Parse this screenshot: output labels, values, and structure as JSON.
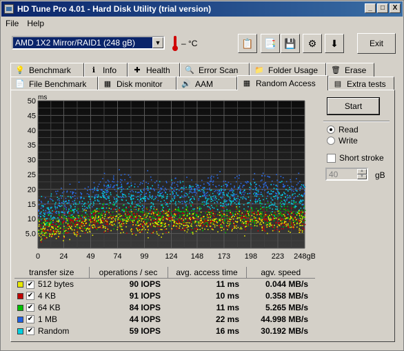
{
  "window": {
    "title": "HD Tune Pro 4.01 - Hard Disk Utility (trial version)",
    "min": "_",
    "max": "□",
    "close": "X"
  },
  "menu": [
    "File",
    "Help"
  ],
  "toolbar": {
    "device": "AMD      1X2 Mirror/RAID1 (248 gB)",
    "temperature": "– °C",
    "exit_label": "Exit"
  },
  "tabs_row1": [
    {
      "label": "Benchmark",
      "icon": "benchmark-icon",
      "glyph": "💡",
      "w": 107
    },
    {
      "label": "Info",
      "icon": "info-icon",
      "glyph": "ℹ",
      "w": 63
    },
    {
      "label": "Health",
      "icon": "health-icon",
      "glyph": "✚",
      "w": 76
    },
    {
      "label": "Error Scan",
      "icon": "error-scan-icon",
      "glyph": "🔍",
      "w": 101
    },
    {
      "label": "Folder Usage",
      "icon": "folder-icon",
      "glyph": "📁",
      "w": 111
    },
    {
      "label": "Erase",
      "icon": "erase-icon",
      "glyph": "🗑",
      "w": 70
    }
  ],
  "tabs_row2": [
    {
      "label": "File Benchmark",
      "icon": "file-benchmark-icon",
      "glyph": "📄",
      "w": 127
    },
    {
      "label": "Disk monitor",
      "icon": "disk-monitor-icon",
      "glyph": "▦",
      "w": 114
    },
    {
      "label": "AAM",
      "icon": "aam-icon",
      "glyph": "🔊",
      "w": 88
    },
    {
      "label": "Random Access",
      "icon": "random-access-icon",
      "glyph": "▦",
      "w": 132,
      "active": true
    },
    {
      "label": "Extra tests",
      "icon": "extra-tests-icon",
      "glyph": "▤",
      "w": 96
    }
  ],
  "controls": {
    "start_label": "Start",
    "read_label": "Read",
    "write_label": "Write",
    "short_stroke_label": "Short stroke",
    "stroke_value": "40",
    "stroke_unit": "gB"
  },
  "stats": {
    "headers": [
      "transfer size",
      "operations / sec",
      "avg. access time",
      "agv. speed"
    ],
    "rows": [
      {
        "size": "512 bytes",
        "color": "#e8e800",
        "iops": "90 IOPS",
        "access": "11 ms",
        "speed": "0.044 MB/s"
      },
      {
        "size": "4 KB",
        "color": "#c00000",
        "iops": "91 IOPS",
        "access": "10 ms",
        "speed": "0.358 MB/s"
      },
      {
        "size": "64 KB",
        "color": "#00c000",
        "iops": "84 IOPS",
        "access": "11 ms",
        "speed": "5.265 MB/s"
      },
      {
        "size": "1 MB",
        "color": "#2060e0",
        "iops": "44 IOPS",
        "access": "22 ms",
        "speed": "44.998 MB/s"
      },
      {
        "size": "Random",
        "color": "#00d0e0",
        "iops": "59 IOPS",
        "access": "16 ms",
        "speed": "30.192 MB/s"
      }
    ]
  },
  "chart_data": {
    "type": "scatter",
    "ylabel": "ms",
    "ylim": [
      0,
      50
    ],
    "xlim": [
      0,
      248
    ],
    "y_ticks": [
      "50",
      "45",
      "40",
      "35",
      "30",
      "25",
      "20",
      "15",
      "10",
      "5.0"
    ],
    "x_ticks": [
      "0",
      "24",
      "49",
      "74",
      "99",
      "124",
      "148",
      "173",
      "198",
      "223",
      "248gB"
    ],
    "grid": true,
    "series": [
      {
        "name": "512 bytes",
        "color": "#e8e800",
        "y_center": 9,
        "y_spread": 4
      },
      {
        "name": "4 KB",
        "color": "#d00000",
        "y_center": 10,
        "y_spread": 4
      },
      {
        "name": "64 KB",
        "color": "#00c000",
        "y_center": 11,
        "y_spread": 4
      },
      {
        "name": "1 MB",
        "color": "#2a6ae8",
        "y_center": 20,
        "y_spread": 5
      },
      {
        "name": "Random",
        "color": "#00d0e0",
        "y_center": 17,
        "y_spread": 5
      }
    ]
  }
}
